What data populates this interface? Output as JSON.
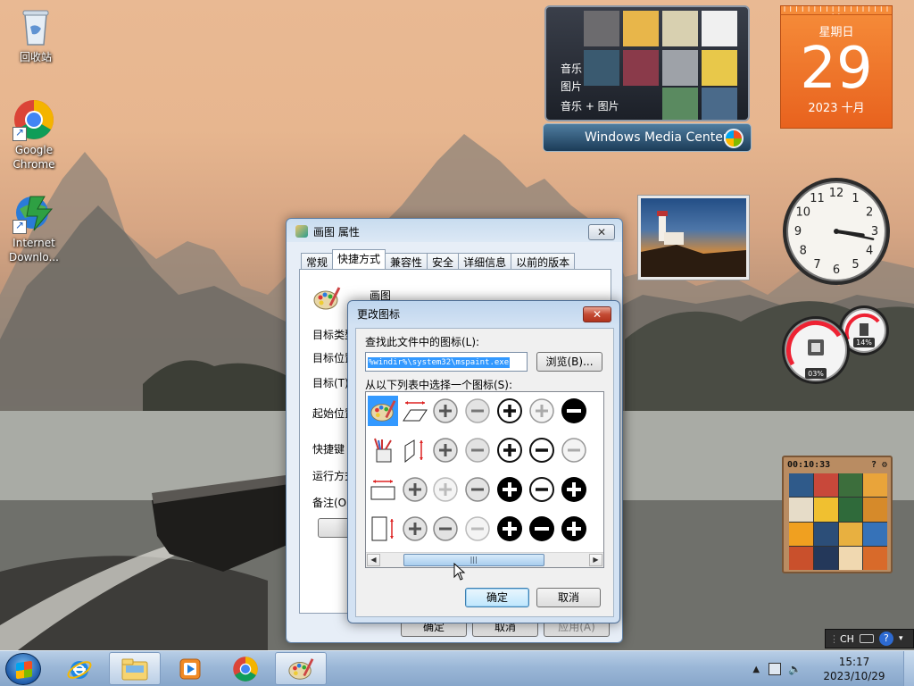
{
  "desktop": {
    "icons": [
      {
        "label": "回收站"
      },
      {
        "label": "Google Chrome"
      },
      {
        "label": "Internet Downlo..."
      }
    ]
  },
  "gadgets": {
    "media_center": {
      "items": [
        "音乐",
        "图片",
        "音乐 + 图片"
      ],
      "bar_label": "Windows Media Center"
    },
    "calendar": {
      "weekday": "星期日",
      "day": "29",
      "year_month": "2023 十月"
    },
    "cpu_meter": {
      "cpu_percent": "03%",
      "memory_percent": "14%",
      "cpu": 0.03,
      "memory": 0.14
    },
    "clock": {
      "hour": 3,
      "minute": 17
    },
    "puzzle": {
      "timer": "00:10:33"
    }
  },
  "properties_dialog": {
    "title": "画图 属性",
    "close_label": "✕",
    "tabs": [
      "常规",
      "快捷方式",
      "兼容性",
      "安全",
      "详细信息",
      "以前的版本"
    ],
    "active_tab": 1,
    "app_name": "画图",
    "labels": [
      "目标类型",
      "目标位置",
      "目标(T)",
      "起始位置",
      "快捷键",
      "运行方式",
      "备注(O)"
    ],
    "open_button": "打开",
    "ok_label": "确定",
    "cancel_label": "取消",
    "apply_label": "应用(A)"
  },
  "change_icon_dialog": {
    "title": "更改图标",
    "close_label": "✕",
    "find_label": "查找此文件中的图标(L):",
    "path_value": "%windir%\\system32\\mspaint.exe",
    "browse_label": "浏览(B)...",
    "select_label": "从以下列表中选择一个图标(S):",
    "ok_label": "确定",
    "cancel_label": "取消",
    "scroll_position": 0.32
  },
  "taskbar": {
    "buttons": [
      "start-orb",
      "internet-explorer",
      "windows-explorer",
      "media-player",
      "google-chrome",
      "paint"
    ],
    "active": "windows-explorer",
    "tray": {
      "language": "CH",
      "time": "15:17",
      "date": "2023/10/29"
    }
  }
}
